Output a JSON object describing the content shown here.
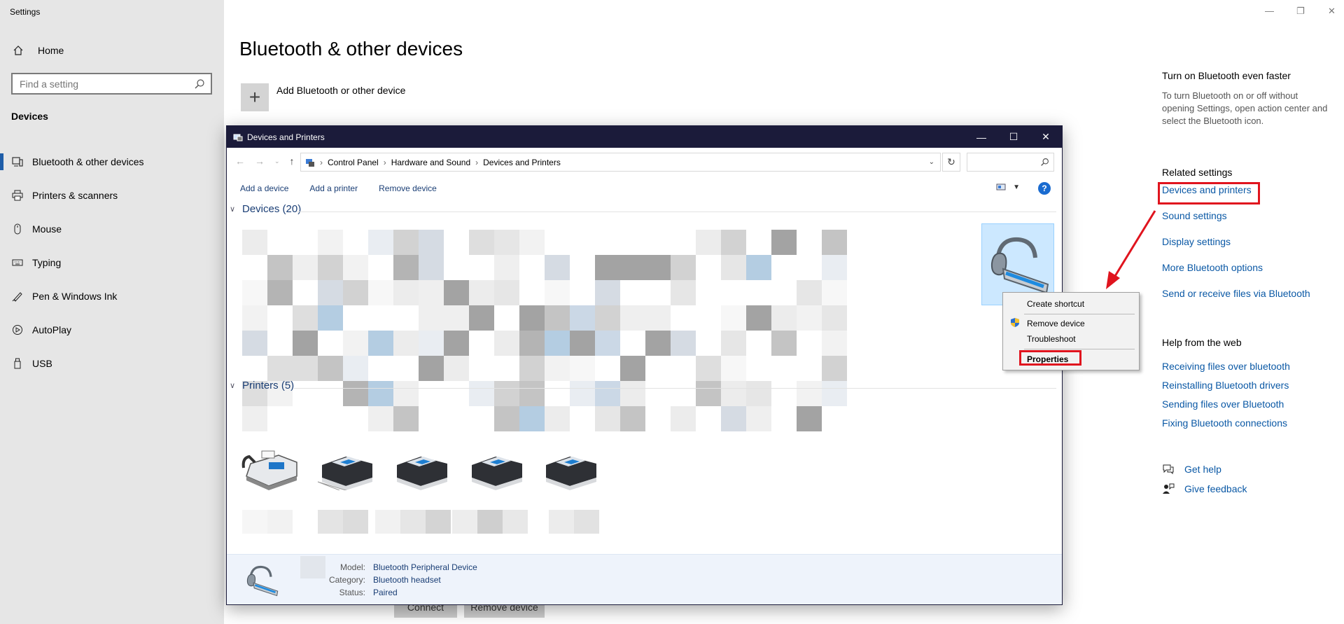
{
  "settings": {
    "app_title": "Settings",
    "home_label": "Home",
    "search_placeholder": "Find a setting",
    "section_label": "Devices",
    "nav": [
      {
        "label": "Bluetooth & other devices",
        "icon": "bluetooth-devices-icon"
      },
      {
        "label": "Printers & scanners",
        "icon": "printer-icon"
      },
      {
        "label": "Mouse",
        "icon": "mouse-icon"
      },
      {
        "label": "Typing",
        "icon": "keyboard-icon"
      },
      {
        "label": "Pen & Windows Ink",
        "icon": "pen-icon"
      },
      {
        "label": "AutoPlay",
        "icon": "autoplay-icon"
      },
      {
        "label": "USB",
        "icon": "usb-icon"
      }
    ],
    "active_nav": "Bluetooth & other devices",
    "page_title": "Bluetooth & other devices",
    "add_device_label": "Add Bluetooth or other device",
    "ghost_buttons": [
      "Connect",
      "Remove device"
    ]
  },
  "right_panel": {
    "tip_title": "Turn on Bluetooth even faster",
    "tip_text": "To turn Bluetooth on or off without opening Settings, open action center and select the Bluetooth icon.",
    "related_title": "Related settings",
    "related_links": [
      "Devices and printers",
      "Sound settings",
      "Display settings",
      "More Bluetooth options",
      "Send or receive files via Bluetooth"
    ],
    "help_title": "Help from the web",
    "help_links": [
      "Receiving files over bluetooth",
      "Reinstalling Bluetooth drivers",
      "Sending files over Bluetooth",
      "Fixing Bluetooth connections"
    ],
    "get_help": "Get help",
    "give_feedback": "Give feedback"
  },
  "window": {
    "title": "Devices and Printers",
    "breadcrumb": [
      "Control Panel",
      "Hardware and Sound",
      "Devices and Printers"
    ],
    "commands": [
      "Add a device",
      "Add a printer",
      "Remove device"
    ],
    "help_label": "?",
    "devices_group": "Devices (20)",
    "printers_group": "Printers (5)",
    "details": {
      "model_label": "Model:",
      "model_value": "Bluetooth Peripheral Device",
      "category_label": "Category:",
      "category_value": "Bluetooth headset",
      "status_label": "Status:",
      "status_value": "Paired"
    }
  },
  "context_menu": {
    "items": [
      "Create shortcut",
      "Remove device",
      "Troubleshoot",
      "Properties"
    ]
  },
  "colors": {
    "highlight_red": "#e0141e",
    "link_blue": "#0a58a5",
    "title_bar": "#1b1b3a",
    "selection": "#cce8ff"
  }
}
